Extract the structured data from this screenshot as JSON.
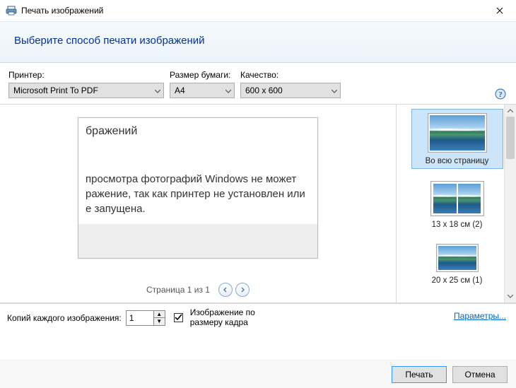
{
  "window": {
    "title": "Печать изображений"
  },
  "header": {
    "heading": "Выберите способ печати изображений"
  },
  "selectors": {
    "printer_label": "Принтер:",
    "printer_value": "Microsoft Print To PDF",
    "paper_label": "Размер бумаги:",
    "paper_value": "A4",
    "quality_label": "Качество:",
    "quality_value": "600 x 600"
  },
  "preview": {
    "heading_fragment": "бражений",
    "body_line1": " просмотра фотографий Windows не может",
    "body_line2": "ражение, так как принтер не установлен или",
    "body_line3": "е запущена."
  },
  "pager": {
    "text": "Страница 1 из 1"
  },
  "layouts": {
    "items": [
      {
        "label": "Во всю страницу"
      },
      {
        "label": "13 x 18 см (2)"
      },
      {
        "label": "20 x 25 см (1)"
      }
    ]
  },
  "copies": {
    "label": "Копий каждого изображения:",
    "value": "1",
    "fit_label": "Изображение по размеру кадра"
  },
  "links": {
    "params": "Параметры..."
  },
  "buttons": {
    "print": "Печать",
    "cancel": "Отмена"
  }
}
